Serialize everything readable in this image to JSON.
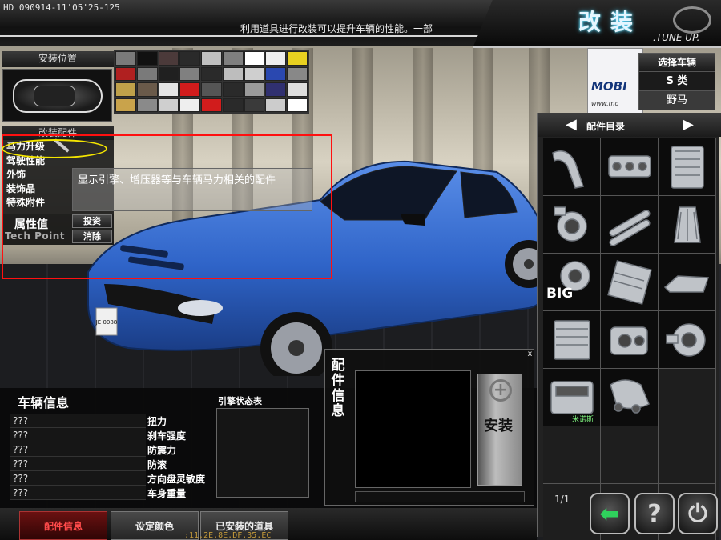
{
  "hud": {
    "id_text": "HD 090914-11'05'25-125",
    "ticker": "利用道具进行改装可以提升车辆的性能。一部"
  },
  "title": {
    "main": "改装",
    "sub": ".TUNE UP."
  },
  "left": {
    "install_position": "安装位置",
    "parts_heading": "改装配件",
    "categories": [
      "马力升级",
      "驾驶性能",
      "外饰",
      "装饰品",
      "特殊附件"
    ],
    "attr_label": "属性值",
    "tech_point": "Tech Point",
    "invest_button": "投资",
    "clear_button": "消除",
    "tooltip": "显示引擎、增压器等与车辆马力相关的配件"
  },
  "swatches": [
    "#7a7a7a",
    "#111111",
    "#4b3a3a",
    "#2a2a2a",
    "#c0c0c0",
    "#7f7f7f",
    "#ffffff",
    "#eeeeee",
    "#e8d020",
    "#b02020",
    "#7a7a7a",
    "#202020",
    "#808080",
    "#2a2a2a",
    "#bdbdbd",
    "#cfcfcf",
    "#2a48b0",
    "#888888",
    "#bfa14a",
    "#6a5a4a",
    "#e5e5e5",
    "#d11c1c",
    "#555555",
    "#2a2a2a",
    "#9a9a9a",
    "#303070",
    "#dddddd",
    "#c9a34b",
    "#8a8a8a",
    "#cfcfcf",
    "#eeeeee",
    "#d11c1c",
    "#2a2a2a",
    "#3a3a3a",
    "#cccccc",
    "#ffffff"
  ],
  "banner": {
    "brand": "MOBI",
    "url": "www.mo"
  },
  "class_select": {
    "heading": "选择车辆",
    "class": "S 类",
    "model": "野马"
  },
  "catalog": {
    "heading": "配件目录",
    "big_label": "BIG",
    "brand_label": "米诺斯",
    "page": "1/1",
    "items": [
      "intake-pipe-icon",
      "intake-manifold-icon",
      "intercooler-icon",
      "throttle-body-icon",
      "camshaft-icon",
      "air-filter-icon",
      "big-turbo-icon",
      "radiator-core-icon",
      "oil-pan-icon",
      "oil-cooler-icon",
      "supercharger-icon",
      "turbocharger-icon",
      "engine-block-icon",
      "exhaust-manifold-icon",
      "",
      "",
      "",
      "",
      "",
      "",
      ""
    ]
  },
  "vehicle_info": {
    "heading": "车辆信息",
    "engine_chart": "引擎状态表",
    "stats": [
      {
        "value": "???",
        "label": "扭力"
      },
      {
        "value": "???",
        "label": "刹车强度"
      },
      {
        "value": "???",
        "label": "防震力"
      },
      {
        "value": "???",
        "label": "防滚"
      },
      {
        "value": "???",
        "label": "方向盘灵敏度"
      },
      {
        "value": "???",
        "label": "车身重量"
      }
    ]
  },
  "part_info": {
    "label": "配件信息",
    "install_button": "安装",
    "close": "x"
  },
  "tabs": [
    "配件信息",
    "设定颜色",
    "已安装的道具"
  ],
  "debug": ":11.2E.8E.DF.35.EC",
  "car": {
    "plate": "JE 0088",
    "color": "#2f64c8"
  }
}
